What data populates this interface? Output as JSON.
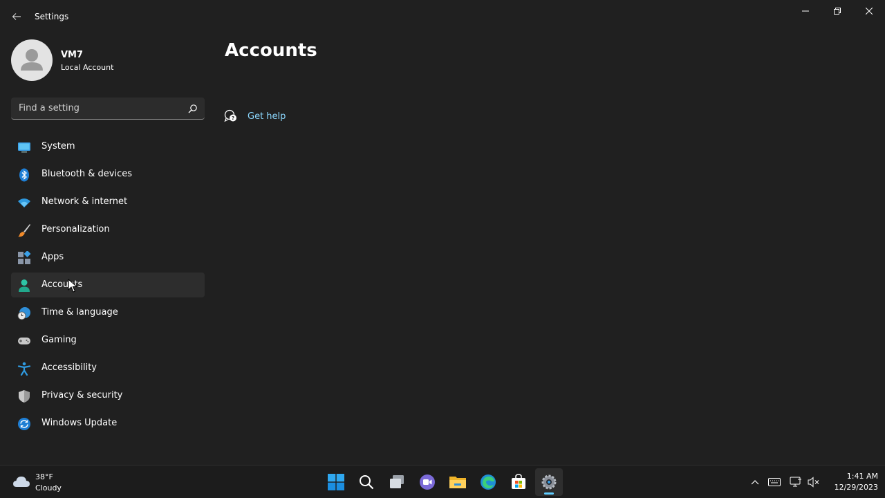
{
  "window": {
    "title": "Settings"
  },
  "profile": {
    "name": "VM7",
    "account_type": "Local Account"
  },
  "search": {
    "placeholder": "Find a setting"
  },
  "sidebar": {
    "items": [
      {
        "label": "System",
        "icon": "system-icon"
      },
      {
        "label": "Bluetooth & devices",
        "icon": "bluetooth-icon"
      },
      {
        "label": "Network & internet",
        "icon": "wifi-icon"
      },
      {
        "label": "Personalization",
        "icon": "brush-icon"
      },
      {
        "label": "Apps",
        "icon": "apps-icon"
      },
      {
        "label": "Accounts",
        "icon": "person-icon",
        "selected": true
      },
      {
        "label": "Time & language",
        "icon": "globe-clock-icon"
      },
      {
        "label": "Gaming",
        "icon": "gamepad-icon"
      },
      {
        "label": "Accessibility",
        "icon": "accessibility-icon"
      },
      {
        "label": "Privacy & security",
        "icon": "shield-icon"
      },
      {
        "label": "Windows Update",
        "icon": "update-icon"
      }
    ]
  },
  "main": {
    "page_title": "Accounts",
    "help_link": "Get help"
  },
  "taskbar": {
    "weather": {
      "temperature": "38°F",
      "condition": "Cloudy"
    },
    "apps": [
      "start-icon",
      "search-icon",
      "task-view-icon",
      "chat-icon",
      "file-explorer-icon",
      "edge-icon",
      "store-icon",
      "settings-icon"
    ],
    "active_app": "settings-icon",
    "clock": {
      "time": "1:41 AM",
      "date": "12/29/2023"
    }
  },
  "colors": {
    "background": "#202020",
    "accent": "#60cdff",
    "link": "#8cd8ff",
    "selected_item": "#2d2d2d"
  }
}
